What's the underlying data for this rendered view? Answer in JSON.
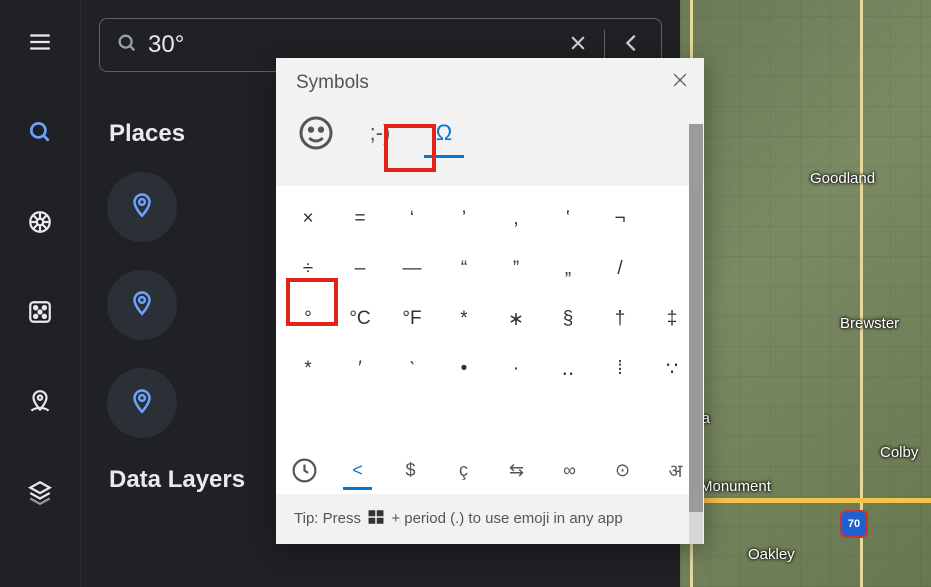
{
  "search": {
    "value": "30°",
    "placeholder": ""
  },
  "panel": {
    "places_heading": "Places",
    "data_layers_heading": "Data Layers"
  },
  "symbols_panel": {
    "title": "Symbols",
    "tabs": {
      "emoji": "☺",
      "kaomoji": ";-)",
      "symbols": "Ω"
    },
    "grid": [
      "×",
      "=",
      "‘",
      "’",
      "‚",
      "‛",
      "¬",
      "",
      "÷",
      "–",
      "—",
      "“",
      "”",
      "„",
      "/",
      "",
      "°",
      "°C",
      "°F",
      "*",
      "∗",
      "§",
      "†",
      "‡",
      "*",
      "′",
      "‵",
      "•",
      "·",
      "‥",
      "⁞",
      "∵"
    ],
    "categories": [
      "⌚",
      "<",
      "$",
      "ç",
      "⇆",
      "∞",
      "⊙",
      "अ"
    ],
    "tip_prefix": "Tip: Press ",
    "tip_suffix": " + period (.) to use emoji in any app"
  },
  "map": {
    "labels": {
      "goodland": "Goodland",
      "brewster": "Brewster",
      "ona": "ona",
      "monument": "Monument",
      "oakley": "Oakley",
      "colby": "Colby"
    },
    "shield": "70"
  }
}
